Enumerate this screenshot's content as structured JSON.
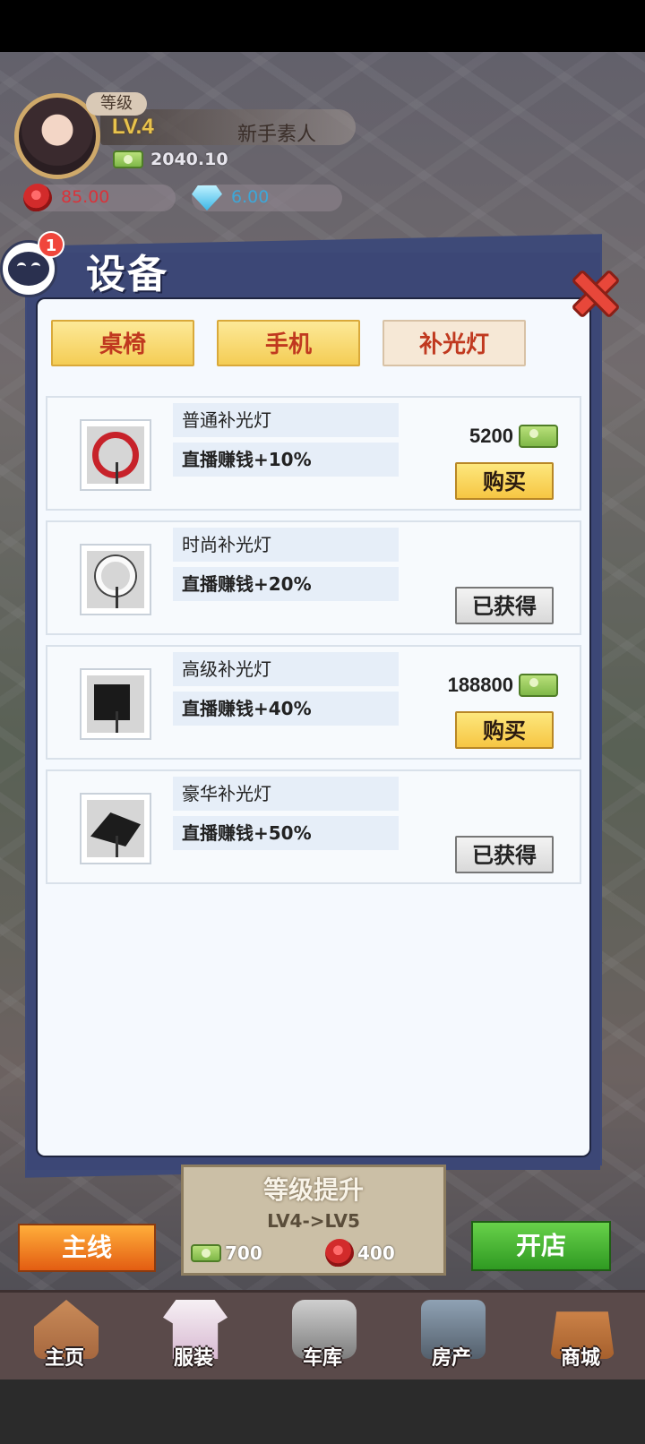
{
  "profile": {
    "level_tag": "等级",
    "level": "LV.4",
    "rank": "新手素人",
    "money": "2040.10",
    "roses": "85.00",
    "diamonds": "6.00"
  },
  "chat": {
    "badge_count": "1"
  },
  "panel": {
    "title": "设备",
    "tabs": [
      {
        "label": "桌椅",
        "active": false
      },
      {
        "label": "手机",
        "active": false
      },
      {
        "label": "补光灯",
        "active": true
      }
    ],
    "items": [
      {
        "name": "普通补光灯",
        "effect": "直播赚钱+10%",
        "price": "5200",
        "button": "购买",
        "state": "buy",
        "icon": "ring-light-red-icon"
      },
      {
        "name": "时尚补光灯",
        "effect": "直播赚钱+20%",
        "price": "",
        "button": "已获得",
        "state": "owned",
        "icon": "ring-light-white-icon"
      },
      {
        "name": "高级补光灯",
        "effect": "直播赚钱+40%",
        "price": "188800",
        "button": "购买",
        "state": "buy",
        "icon": "softbox-light-icon"
      },
      {
        "name": "豪华补光灯",
        "effect": "直播赚钱+50%",
        "price": "",
        "button": "已获得",
        "state": "owned",
        "icon": "umbrella-light-icon"
      }
    ]
  },
  "bottom": {
    "main_button": "主线",
    "open_button": "开店",
    "upgrade": {
      "title": "等级提升",
      "levels": "LV4->LV5",
      "cost_money": "700",
      "cost_roses": "400"
    }
  },
  "nav": [
    {
      "label": "主页",
      "icon": "home-icon"
    },
    {
      "label": "服装",
      "icon": "clothes-icon"
    },
    {
      "label": "车库",
      "icon": "garage-icon"
    },
    {
      "label": "房产",
      "icon": "house-icon"
    },
    {
      "label": "商城",
      "icon": "shop-icon"
    }
  ],
  "colors": {
    "panel_frame": "#3e4a78",
    "accent_red": "#c0391f",
    "buy_yellow": "#f6c643",
    "open_green": "#2f9a22"
  }
}
